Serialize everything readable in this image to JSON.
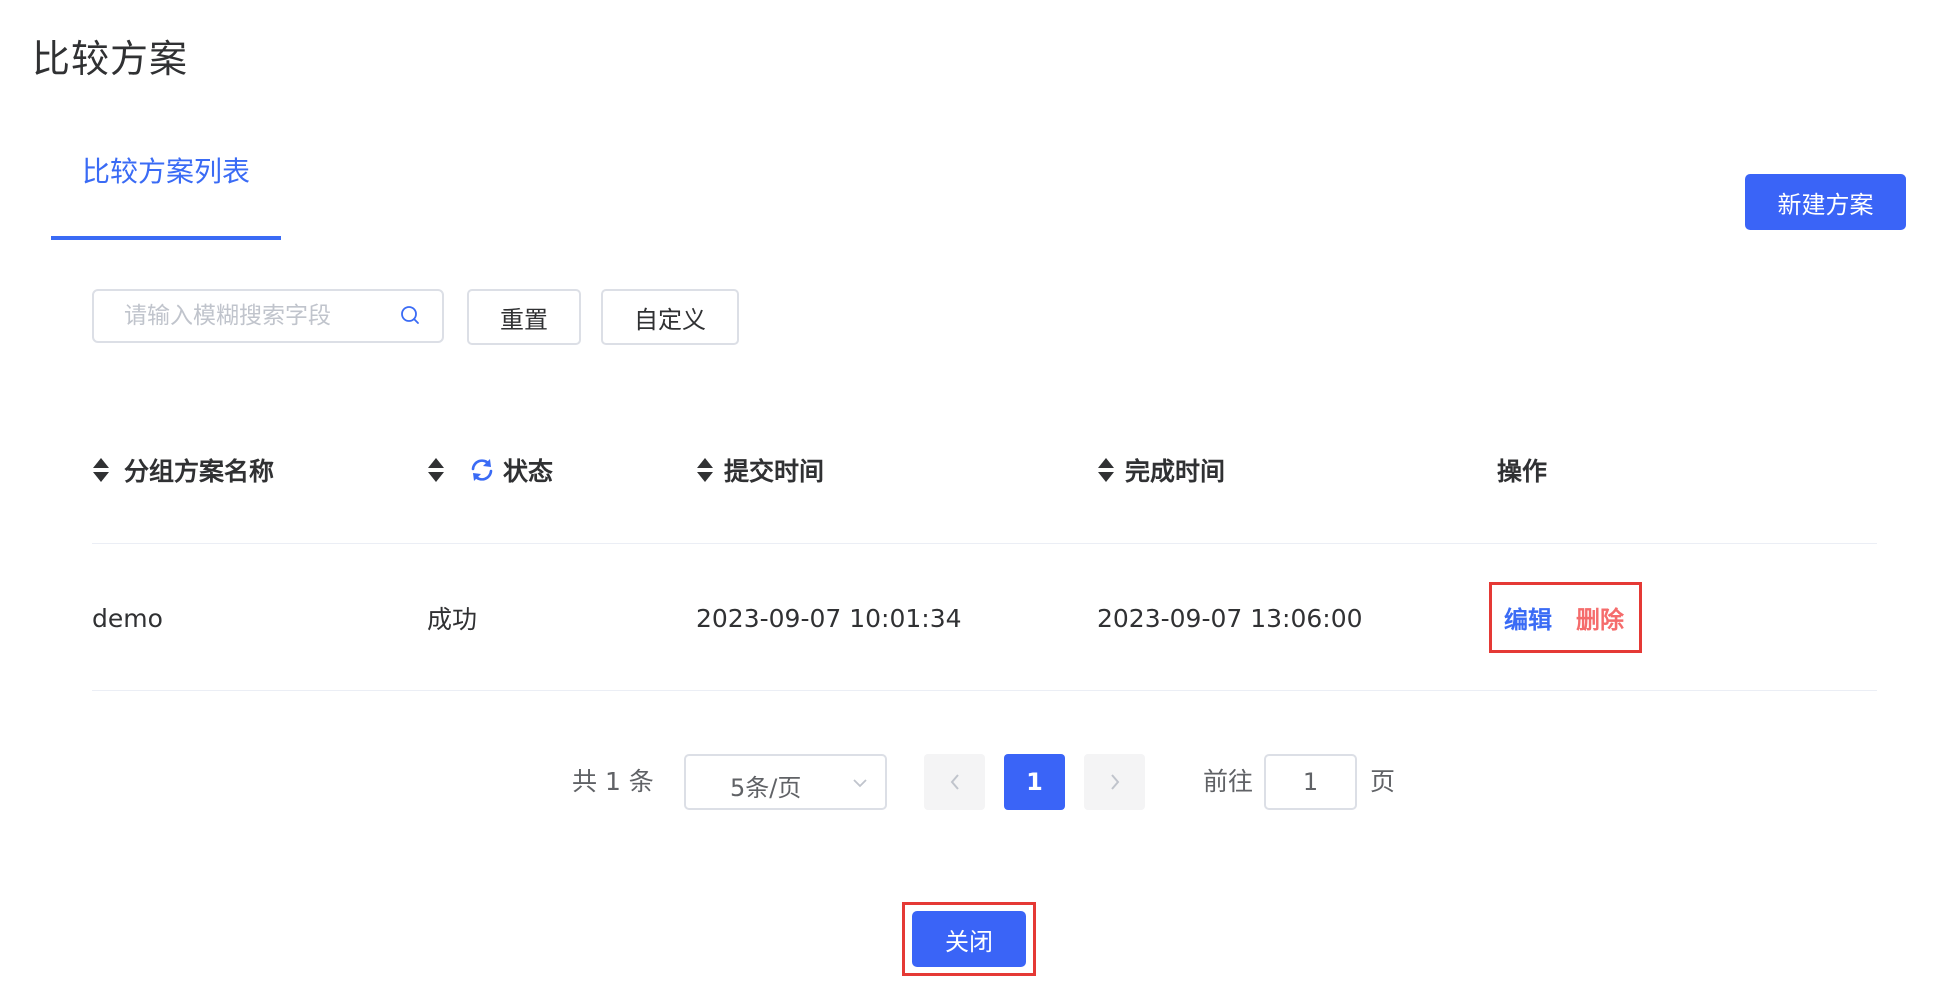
{
  "page": {
    "title": "比较方案"
  },
  "tabs": [
    {
      "label": "比较方案列表"
    }
  ],
  "toolbar": {
    "new_button": "新建方案",
    "search_placeholder": "请输入模糊搜索字段",
    "reset_button": "重置",
    "custom_button": "自定义"
  },
  "table": {
    "columns": [
      "分组方案名称",
      "状态",
      "提交时间",
      "完成时间",
      "操作"
    ],
    "rows": [
      {
        "name": "demo",
        "status": "成功",
        "submit_time": "2023-09-07 10:01:34",
        "finish_time": "2023-09-07 13:06:00",
        "actions": [
          "编辑",
          "删除"
        ]
      }
    ]
  },
  "pagination": {
    "total_text": "共 1 条",
    "page_size": "5条/页",
    "current_page": "1",
    "goto_label": "前往",
    "goto_value": "1",
    "goto_suffix": "页"
  },
  "footer": {
    "close_button": "关闭"
  },
  "colors": {
    "primary": "#3a64f7",
    "link": "#3a6bf5",
    "danger": "#f56c6c",
    "highlight_border": "#e53935"
  }
}
